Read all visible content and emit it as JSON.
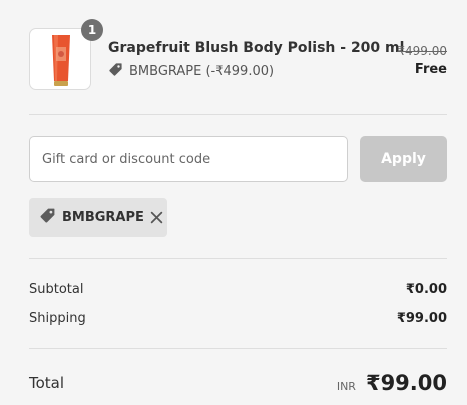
{
  "line_item": {
    "quantity": "1",
    "product_name": "Grapefruit Blush Body Polish - 200 ml",
    "discount_text": "BMBGRAPE (-₹499.00)",
    "original_price": "₹499.00",
    "final_price": "Free"
  },
  "discount_form": {
    "placeholder": "Gift card or discount code",
    "apply_label": "Apply"
  },
  "applied_code": {
    "label": "BMBGRAPE"
  },
  "summary": {
    "subtotal_label": "Subtotal",
    "subtotal_value": "₹0.00",
    "shipping_label": "Shipping",
    "shipping_value": "₹99.00",
    "total_label": "Total",
    "currency": "INR",
    "total_value": "₹99.00"
  },
  "colors": {
    "background": "#f5f5f5",
    "apply_disabled": "#c7c7c7",
    "badge": "#707070",
    "chip": "#e3e3e3"
  },
  "icons": {
    "discount_tag": "tag-icon",
    "remove": "close-icon"
  }
}
